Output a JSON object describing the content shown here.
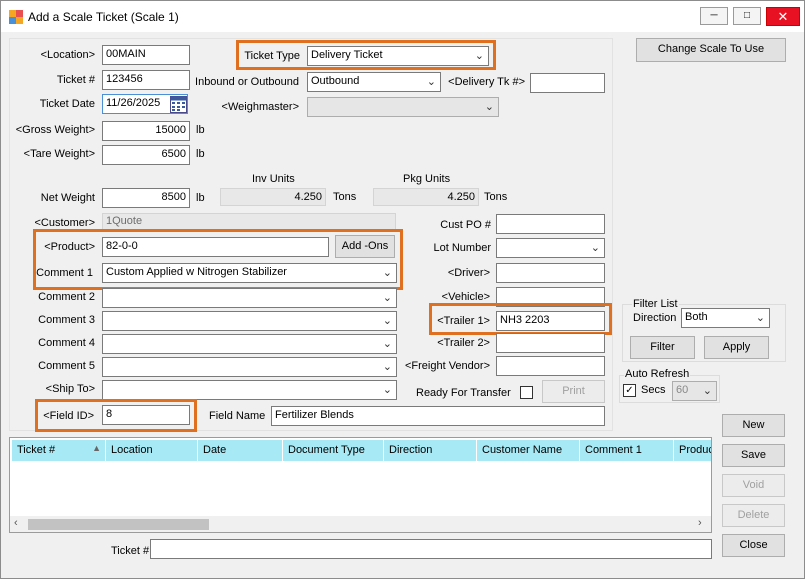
{
  "window": {
    "title": "Add a Scale Ticket (Scale 1)",
    "minimize": "─",
    "maximize": "□",
    "close": "✕"
  },
  "form": {
    "location_label": "<Location>",
    "location_value": "00MAIN",
    "ticket_type_label": "Ticket Type",
    "ticket_type_value": "Delivery Ticket",
    "ticket_no_label": "Ticket #",
    "ticket_no_value": "123456",
    "inbound_label": "Inbound or Outbound",
    "inbound_value": "Outbound",
    "delivery_tk_label": "<Delivery Tk #>",
    "delivery_tk_value": "",
    "ticket_date_label": "Ticket Date",
    "ticket_date_value": "11/26/2025",
    "weighmaster_label": "<Weighmaster>",
    "weighmaster_value": "",
    "gross_label": "<Gross Weight>",
    "gross_value": "15000",
    "gross_unit": "lb",
    "tare_label": "<Tare Weight>",
    "tare_value": "6500",
    "tare_unit": "lb",
    "inv_units_label": "Inv Units",
    "inv_units_value": "4.250",
    "inv_units_unit": "Tons",
    "pkg_units_label": "Pkg Units",
    "pkg_units_value": "4.250",
    "pkg_units_unit": "Tons",
    "net_label": "Net Weight",
    "net_value": "8500",
    "net_unit": "lb",
    "customer_label": "<Customer>",
    "customer_value": "1Quote",
    "cust_po_label": "Cust PO #",
    "cust_po_value": "",
    "product_label": "<Product>",
    "product_value": "82-0-0",
    "addons_label": "Add -Ons",
    "lot_label": "Lot Number",
    "lot_value": "",
    "comment1_label": "Comment 1",
    "comment1_value": "Custom Applied w Nitrogen Stabilizer",
    "driver_label": "<Driver>",
    "driver_value": "",
    "comment2_label": "Comment 2",
    "comment2_value": "",
    "vehicle_label": "<Vehicle>",
    "vehicle_value": "",
    "comment3_label": "Comment 3",
    "comment3_value": "",
    "trailer1_label": "<Trailer 1>",
    "trailer1_value": "NH3 2203",
    "comment4_label": "Comment 4",
    "comment4_value": "",
    "trailer2_label": "<Trailer 2>",
    "trailer2_value": "",
    "comment5_label": "Comment 5",
    "comment5_value": "",
    "freight_label": "<Freight Vendor>",
    "freight_value": "",
    "shipto_label": "<Ship To>",
    "shipto_value": "",
    "ready_label": "Ready For Transfer",
    "print_label": "Print",
    "fieldid_label": "<Field ID>",
    "fieldid_value": "8",
    "fieldname_label": "Field Name",
    "fieldname_value": "Fertilizer Blends"
  },
  "right": {
    "change_scale": "Change Scale To Use",
    "filter_list": "Filter List",
    "direction_label": "Direction",
    "direction_value": "Both",
    "filter_btn": "Filter",
    "apply_btn": "Apply",
    "auto_refresh": "Auto Refresh",
    "secs_label": "Secs",
    "secs_value": "60",
    "new_btn": "New",
    "save_btn": "Save",
    "void_btn": "Void",
    "delete_btn": "Delete",
    "close_btn": "Close"
  },
  "grid": {
    "columns": [
      "Ticket #",
      "Location",
      "Date",
      "Document Type",
      "Direction",
      "Customer Name",
      "Comment 1",
      "Produc"
    ]
  },
  "bottom": {
    "ticket_label": "Ticket #",
    "ticket_value": ""
  }
}
